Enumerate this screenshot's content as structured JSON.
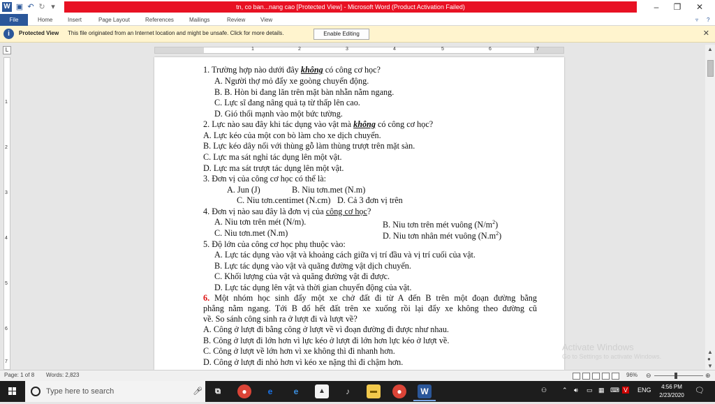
{
  "window": {
    "title": "tn, co ban...nang cao [Protected View] - Microsoft Word (Product Activation Failed)",
    "minimize": "–",
    "maximize": "❐",
    "close": "✕"
  },
  "ribbon": {
    "tabs": [
      "File",
      "Home",
      "Insert",
      "Page Layout",
      "References",
      "Mailings",
      "Review",
      "View"
    ]
  },
  "protected_view": {
    "label": "Protected View",
    "message": "This file originated from an Internet location and might be unsafe. Click for more details.",
    "button": "Enable Editing",
    "close": "✕"
  },
  "ruler": {
    "h_numbers": [
      "1",
      "2",
      "3",
      "4",
      "5",
      "6",
      "7"
    ],
    "v_numbers": [
      "1",
      "2",
      "3",
      "4",
      "5",
      "6",
      "7"
    ]
  },
  "document": {
    "q1": "1. Trường hợp nào dưới đây",
    "q1_em": "không",
    "q1_end": "có công cơ học?",
    "q1a": "A. Người thợ mỏ đẩy xe goòng chuyển động.",
    "q1b": "B. B. Hòn bi đang lăn trên mặt bàn nhẵn nằm ngang.",
    "q1c": "C.   Lực sĩ đang nâng quả tạ từ thấp lên cao.",
    "q1d": "D. Gió thổi mạnh vào một bức tường.",
    "q2": "2. Lực nào sau đây khi tác dụng vào vật mà",
    "q2_em": "không",
    "q2_end": "có công cơ học?",
    "q2a": "A. Lực kéo của một con bò làm cho xe dịch chuyển.",
    "q2b": "B. Lực kéo dây nối với thùng gỗ làm thùng trượt trên mặt sàn.",
    "q2c": "C. Lực ma sát nghỉ tác dụng lên một vật.",
    "q2d": "D.  Lực ma sát trượt tác dụng lên một vật.",
    "q3": "3. Đơn vị của công cơ học có thể là:",
    "q3a": "A. Jun (J)",
    "q3b": "B. Niu tơn.met (N.m)",
    "q3c": "C. Niu tơn.centimet (N.cm)",
    "q3d": "D. Cả 3 đơn vị trên",
    "q4": "4. Đơn vị nào sau đây là đơn vị của",
    "q4_u": "công cơ học",
    "q4_end": "?",
    "q4a": "A. Niu tơn trên mét (N/m).",
    "q4b": "B. Niu tơn trên mét vuông (N/m",
    "q4b_sup": "2",
    "q4b_end": ")",
    "q4c": "C. Niu tơn.met (N.m)",
    "q4d": "D. Niu tơn nhân mét vuông (N.m",
    "q4d_sup": "2",
    "q4d_end": ")",
    "q5": "5. Độ lớn của công cơ học phụ thuộc vào:",
    "q5a": "A. Lực tác dụng vào vật và khoảng cách giữa vị trí đầu và vị trí cuối của vật.",
    "q5b": "B. Lực tác dụng vào vật và quãng đường vật dịch chuyển.",
    "q5c": "C. Khối lượng của vật và quãng đường vật đi được.",
    "q5d": "D. Lực tác dụng lên vật và thời gian chuyển động của vật.",
    "q6_num": "6.",
    "q6_l1": "Một nhóm học sinh đẩy một xe chở đất đi từ A đến B trên một đoạn đường bằng",
    "q6_l2": "phẳng nằm ngang. Tới B đổ hết đất trên xe xuống rồi lại đẩy xe không theo đường cũ",
    "q6_l3": "về. So sánh công sinh ra ở lượt đi và lượt về?",
    "q6a": "A. Công ở lượt đi bằng công ở lượt về vì đoạn đường đi được như nhau.",
    "q6b": "B. Công ở lượt đi lớn hơn vì lực kéo ở lượt đi lớn hơn lực kéo ở lượt về.",
    "q6c": "C. Công ở lượt về lớn hơn vì xe không thì đi nhanh hơn.",
    "q6d": "D. Công ở lượt đi nhỏ hơn vì kéo xe nặng thì đi chậm hơn."
  },
  "watermark": {
    "title": "Activate Windows",
    "subtitle": "Go to Settings to activate Windows."
  },
  "statusbar": {
    "page": "Page: 1 of 8",
    "words": "Words: 2,823",
    "zoom": "96%",
    "zoom_level": 0.96
  },
  "taskbar": {
    "search_placeholder": "Type here to search",
    "time": "4:56 PM",
    "date": "2/23/2020",
    "lang": "ENG"
  },
  "colors": {
    "title_bar": "#e81123",
    "word_blue": "#2b579a",
    "protected_bar": "#fff4ce"
  }
}
